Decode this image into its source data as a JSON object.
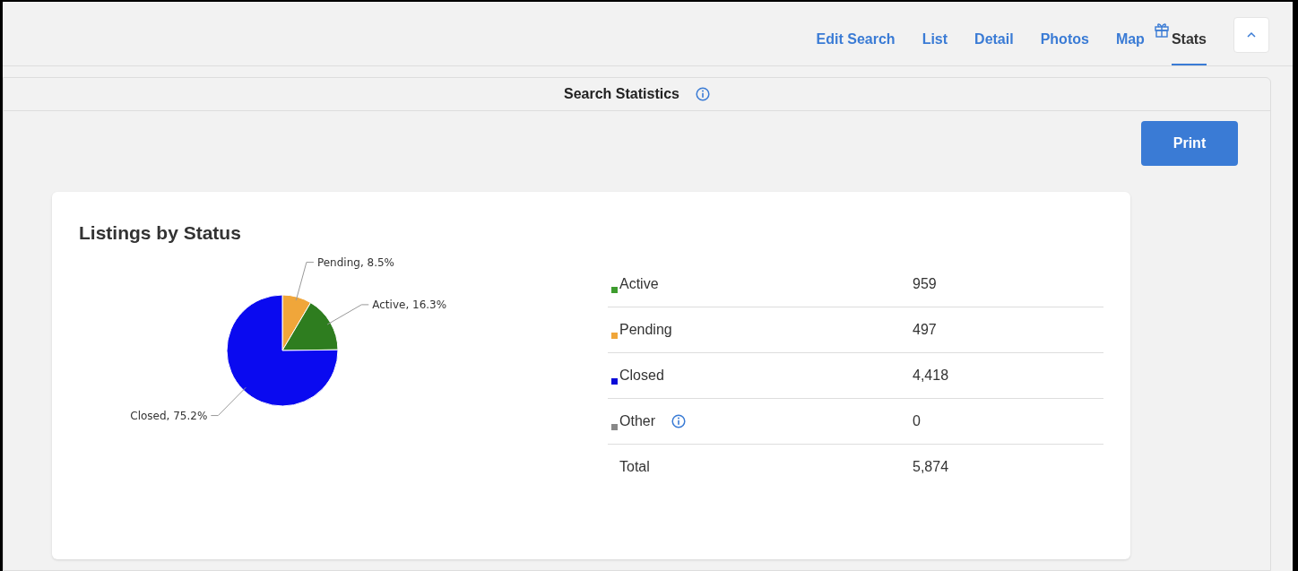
{
  "nav": {
    "tabs": [
      {
        "label": "Edit Search",
        "selected": false
      },
      {
        "label": "List",
        "selected": false
      },
      {
        "label": "Detail",
        "selected": false
      },
      {
        "label": "Photos",
        "selected": false
      },
      {
        "label": "Map",
        "selected": false
      },
      {
        "label": "Stats",
        "selected": true
      }
    ]
  },
  "panel": {
    "title": "Search Statistics",
    "print_button": "Print"
  },
  "card": {
    "title": "Listings by Status",
    "chart_data": {
      "type": "pie",
      "categories": [
        "Pending, 8.5%",
        "Active, 16.3%",
        "Closed, 75.2%"
      ],
      "values": [
        8.5,
        16.3,
        75.2
      ],
      "colors": [
        "#f0a63a",
        "#2e7d1f",
        "#0a0af0"
      ]
    },
    "table": {
      "rows": [
        {
          "label": "Active",
          "value": "959",
          "color": "#3d9c2e",
          "info": false
        },
        {
          "label": "Pending",
          "value": "497",
          "color": "#f0a63a",
          "info": false
        },
        {
          "label": "Closed",
          "value": "4,418",
          "color": "#0a0ad8",
          "info": false
        },
        {
          "label": "Other",
          "value": "0",
          "color": "#888888",
          "info": true
        }
      ],
      "total": {
        "label": "Total",
        "value": "5,874"
      }
    }
  }
}
